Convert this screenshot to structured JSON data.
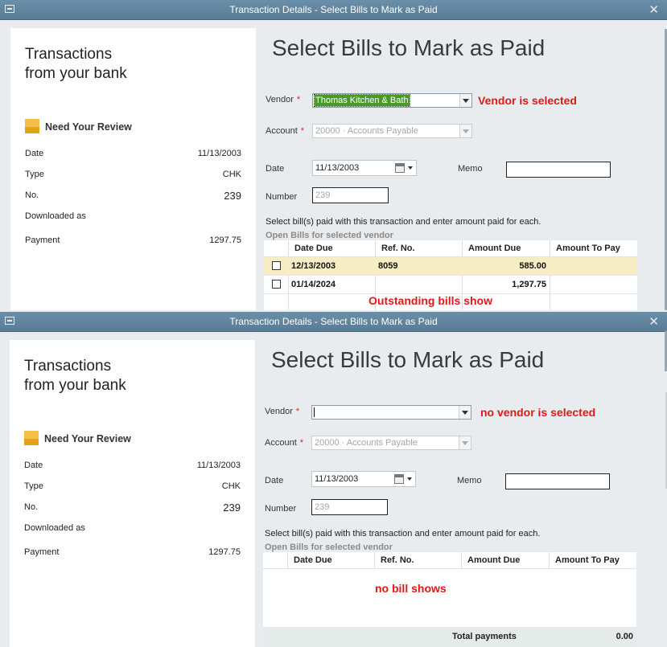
{
  "window_title": "Transaction Details - Select Bills to Mark as Paid",
  "panel_title_line1": "Transactions",
  "panel_title_line2": "from your bank",
  "need_review": "Need Your Review",
  "transaction": {
    "date_label": "Date",
    "date": "11/13/2003",
    "type_label": "Type",
    "type": "CHK",
    "no_label": "No.",
    "no": "239",
    "downloaded_label": "Downloaded as",
    "payment_label": "Payment",
    "payment": "1297.75"
  },
  "heading": "Select Bills to Mark as Paid",
  "labels": {
    "vendor": "Vendor",
    "account": "Account",
    "date": "Date",
    "memo": "Memo",
    "number": "Number",
    "required": "*"
  },
  "account_value": "20000 · Accounts Payable",
  "date_value": "11/13/2003",
  "number_placeholder": "239",
  "instruction": "Select bill(s) paid with this transaction and enter amount paid for each.",
  "open_bills_label": "Open Bills for selected vendor",
  "columns": [
    "Date Due",
    "Ref. No.",
    "Amount Due",
    "Amount To Pay"
  ],
  "colors": {
    "annotation": "#e01818",
    "highlight_row": "#f7edc4",
    "selected_vendor": "#4a9a2a"
  },
  "icons": [
    "close-icon",
    "calendar-icon",
    "chevron-down-icon",
    "flag-icon",
    "system-menu-icon"
  ],
  "window1": {
    "vendor_value": "Thomas Kitchen & Bath",
    "vendor_annotation": "Vendor is selected",
    "bills": [
      {
        "date_due": "12/13/2003",
        "ref_no": "8059",
        "amount_due": "585.00",
        "amount_to_pay": "",
        "checked": false
      },
      {
        "date_due": "01/14/2024",
        "ref_no": "",
        "amount_due": "1,297.75",
        "amount_to_pay": "",
        "checked": false
      }
    ],
    "bills_annotation": "Outstanding bills show"
  },
  "window2": {
    "vendor_value": "",
    "vendor_annotation": "no vendor is selected",
    "bills_annotation": "no bill shows",
    "total_label": "Total payments",
    "total_value": "0.00"
  }
}
